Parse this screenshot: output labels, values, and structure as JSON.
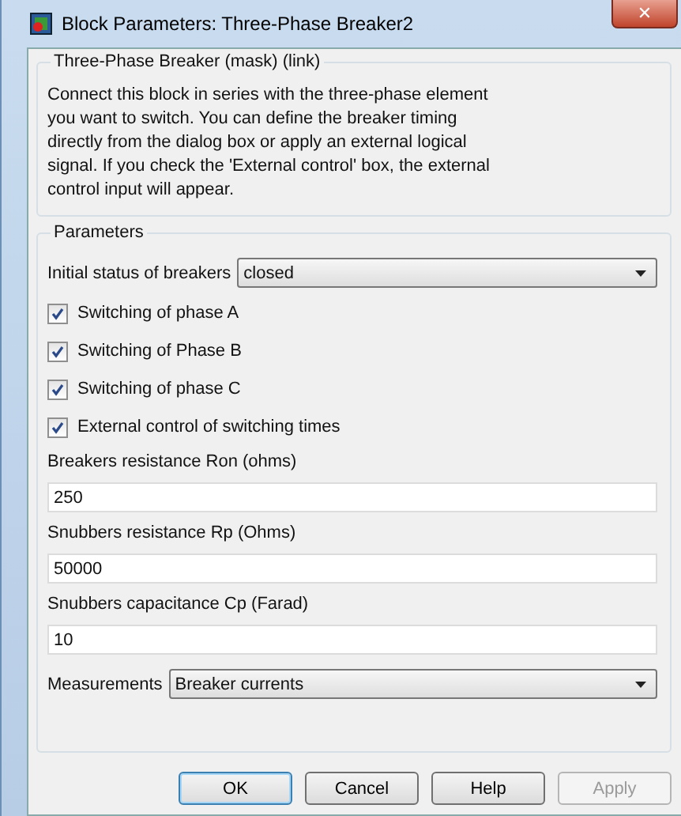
{
  "window": {
    "title": "Block Parameters: Three-Phase Breaker2",
    "close": "✕"
  },
  "description": {
    "title": "Three-Phase Breaker (mask) (link)",
    "text": "Connect this block in series with the three-phase element you want to switch. You can define the breaker timing directly from the dialog box or apply an external logical signal. If you check  the 'External control' box, the external control input will appear."
  },
  "parameters": {
    "title": "Parameters",
    "items": [
      {
        "kind": "dropdown",
        "label": "Initial status of breakers",
        "value": "closed"
      },
      {
        "kind": "checkbox",
        "label": "Switching of phase A",
        "checked": true
      },
      {
        "kind": "checkbox",
        "label": "Switching of Phase B",
        "checked": true
      },
      {
        "kind": "checkbox",
        "label": "Switching of phase C",
        "checked": true
      },
      {
        "kind": "checkbox",
        "label": "External control of switching times",
        "checked": true
      },
      {
        "kind": "field",
        "label": "Breakers resistance Ron (ohms)",
        "value": "250"
      },
      {
        "kind": "field",
        "label": "Snubbers resistance Rp (Ohms)",
        "value": "50000"
      },
      {
        "kind": "field",
        "label": "Snubbers capacitance Cp (Farad)",
        "value": "10"
      },
      {
        "kind": "dropdown",
        "label": "Measurements",
        "value": "Breaker currents"
      }
    ]
  },
  "buttons": [
    {
      "label": "OK",
      "disabled": false,
      "focused": true
    },
    {
      "label": "Cancel",
      "disabled": false,
      "focused": false
    },
    {
      "label": "Help",
      "disabled": false,
      "focused": false
    },
    {
      "label": "Apply",
      "disabled": true,
      "focused": false
    }
  ]
}
